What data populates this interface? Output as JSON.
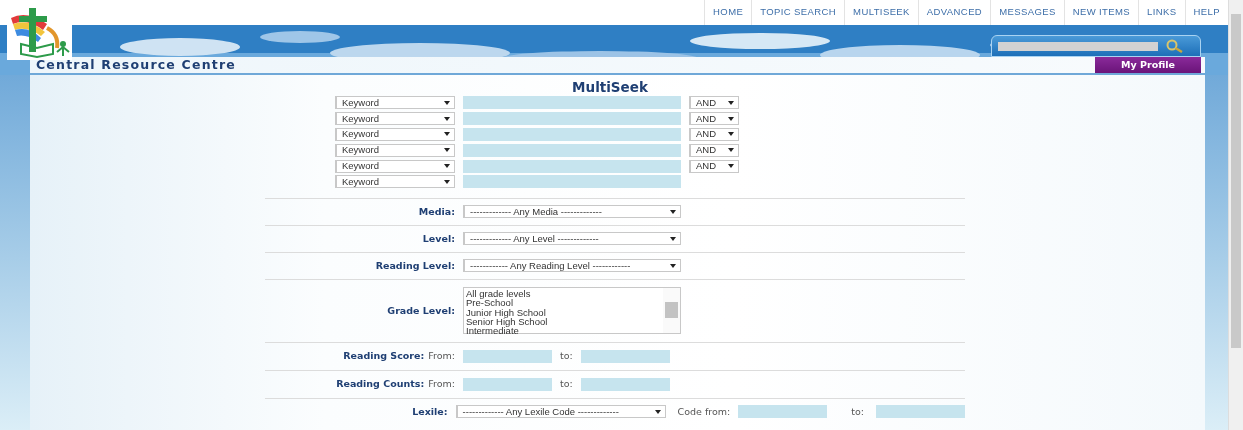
{
  "nav": [
    {
      "label": "HOME"
    },
    {
      "label": "TOPIC SEARCH"
    },
    {
      "label": "MULTISEEK"
    },
    {
      "label": "ADVANCED"
    },
    {
      "label": "MESSAGES"
    },
    {
      "label": "NEW ITEMS"
    },
    {
      "label": "LINKS"
    },
    {
      "label": "HELP"
    }
  ],
  "site_title": "Central Resource Centre",
  "profile_button": "My Profile",
  "form": {
    "title": "MultiSeek",
    "search_rows": [
      {
        "field": "Keyword",
        "operator": "AND"
      },
      {
        "field": "Keyword",
        "operator": "AND"
      },
      {
        "field": "Keyword",
        "operator": "AND"
      },
      {
        "field": "Keyword",
        "operator": "AND"
      },
      {
        "field": "Keyword",
        "operator": "AND"
      },
      {
        "field": "Keyword"
      }
    ],
    "filters": [
      {
        "kind": "select",
        "label": "Media:",
        "value": "------------- Any Media -------------"
      },
      {
        "kind": "select",
        "label": "Level:",
        "value": "------------- Any Level -------------"
      },
      {
        "kind": "select",
        "label": "Reading Level:",
        "value": "------------ Any Reading Level ------------"
      },
      {
        "kind": "listbox",
        "label": "Grade Level:",
        "options": [
          "All grade levels",
          "Pre-School",
          "Junior High School",
          "Senior High School",
          "Intermediate"
        ]
      },
      {
        "kind": "range",
        "label": "Reading Score:",
        "from_label": "From:",
        "to_label": "to:"
      },
      {
        "kind": "range",
        "label": "Reading Counts:",
        "from_label": "From:",
        "to_label": "to:"
      },
      {
        "kind": "select_range",
        "label": "Lexile:",
        "value": "------------- Any Lexile Code -------------",
        "from_label": "Code from:",
        "to_label": "to:"
      }
    ]
  }
}
